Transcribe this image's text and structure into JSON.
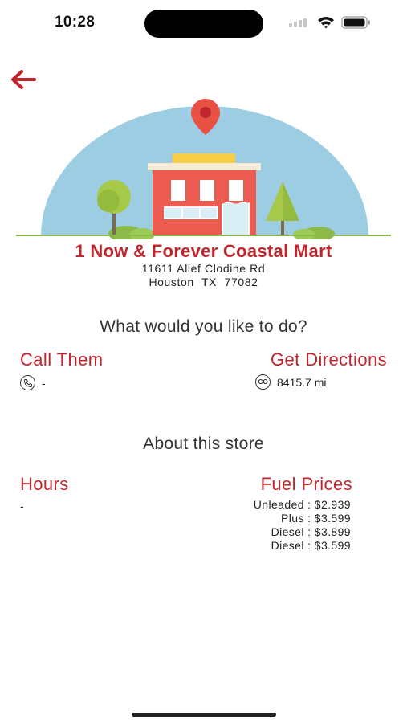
{
  "status_bar": {
    "time": "10:28"
  },
  "store": {
    "name": "1 Now & Forever Coastal Mart",
    "address_line1": "11611 Alief Clodine Rd",
    "address_line2": "Houston  TX  77082"
  },
  "actions": {
    "question": "What would you like to do?",
    "call_label": "Call Them",
    "call_value": "-",
    "directions_label": "Get Directions",
    "directions_icon_text": "GO",
    "distance": "8415.7 mi"
  },
  "about": {
    "title": "About this store",
    "hours_label": "Hours",
    "hours_value": "-",
    "fuel_label": "Fuel Prices",
    "fuel_prices": [
      {
        "grade": "Unleaded",
        "price": "$2.939"
      },
      {
        "grade": "Plus",
        "price": "$3.599"
      },
      {
        "grade": "Diesel",
        "price": "$3.899"
      },
      {
        "grade": "Diesel",
        "price": "$3.599"
      }
    ]
  },
  "colors": {
    "accent": "#c0272d",
    "sky": "#9ccde3",
    "grass": "#8db94a"
  },
  "icons": [
    "back-arrow-icon",
    "location-pin-icon",
    "phone-icon",
    "go-icon",
    "wifi-icon",
    "battery-icon",
    "signal-icon"
  ]
}
